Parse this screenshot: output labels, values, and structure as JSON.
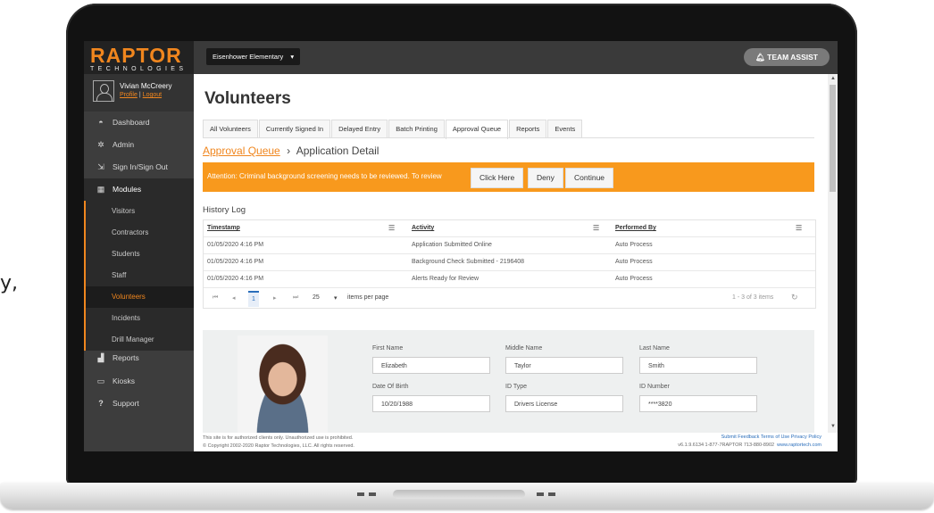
{
  "stray_text": "y,",
  "brand": {
    "logo": "RAPTOR",
    "tagline": "TECHNOLOGIES",
    "accent": "#f0861e"
  },
  "user": {
    "name": "Vivian McCreery",
    "profile": "Profile",
    "logout": "Logout"
  },
  "nav": {
    "dashboard": "Dashboard",
    "admin": "Admin",
    "signinout": "Sign In/Sign Out",
    "modules": "Modules",
    "sub": [
      "Visitors",
      "Contractors",
      "Students",
      "Staff",
      "Volunteers",
      "Incidents",
      "Drill Manager"
    ],
    "reports": "Reports",
    "kiosks": "Kiosks",
    "support": "Support"
  },
  "topbar": {
    "school": "Eisenhower Elementary",
    "team_assist": "TEAM ASSIST"
  },
  "page": {
    "title": "Volunteers"
  },
  "tabs": [
    "All Volunteers",
    "Currently Signed In",
    "Delayed Entry",
    "Batch Printing",
    "Approval Queue",
    "Reports",
    "Events"
  ],
  "breadcrumb": {
    "link": "Approval Queue",
    "current": "Application Detail"
  },
  "alert": {
    "message": "Attention: Criminal background screening needs to be reviewed.  To review",
    "click_here": "Click Here",
    "deny": "Deny",
    "continue": "Continue"
  },
  "history": {
    "title": "History Log",
    "columns": [
      "Timestamp",
      "Activity",
      "Performed By"
    ],
    "rows": [
      [
        "01/05/2020 4:16 PM",
        "Application Submitted Online",
        "Auto Process"
      ],
      [
        "01/05/2020 4:16 PM",
        "Background Check Submitted - 2196408",
        "Auto Process"
      ],
      [
        "01/05/2020 4:16 PM",
        "Alerts Ready for Review",
        "Auto Process"
      ]
    ],
    "pager": {
      "page": "1",
      "per_page": "25",
      "per_page_label": "items per page",
      "summary": "1 - 3 of 3 items"
    }
  },
  "applicant": {
    "labels": {
      "first": "First Name",
      "middle": "Middle Name",
      "last": "Last Name",
      "dob": "Date Of Birth",
      "idtype": "ID Type",
      "idnum": "ID Number"
    },
    "values": {
      "first": "Elizabeth",
      "middle": "Taylor",
      "last": "Smith",
      "dob": "10/20/1988",
      "idtype": "Drivers License",
      "idnum": "****3820"
    }
  },
  "footer": {
    "line1": "This site is for authorized clients only. Unauthorized use is prohibited.",
    "line2": "© Copyright 2002-2020 Raptor Technologies, LLC. All rights reserved.",
    "links": "Submit Feedback   Terms of Use   Privacy Policy",
    "version": "v6.1.9.6134   1-877-7RAPTOR   713-880-8902",
    "website": "www.raptortech.com"
  }
}
